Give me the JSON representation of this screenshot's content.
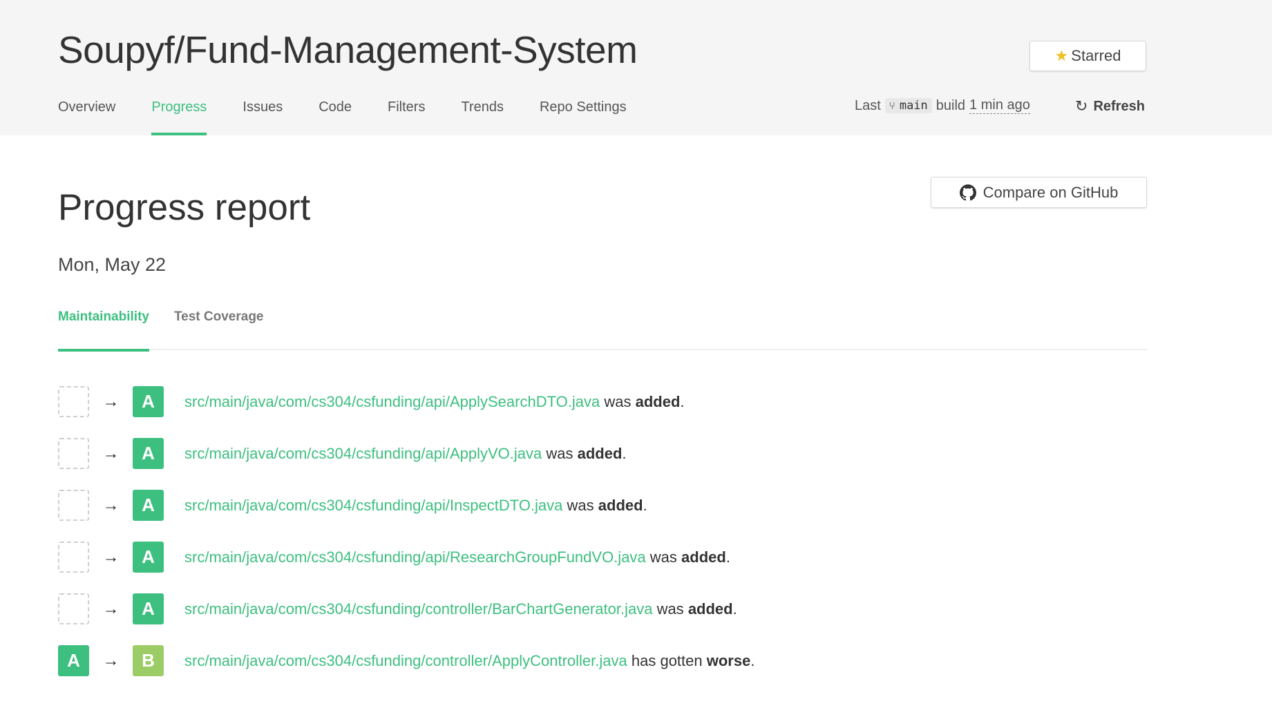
{
  "header": {
    "repo_title": "Soupyf/Fund-Management-System",
    "starred_label": "Starred",
    "nav": [
      {
        "label": "Overview"
      },
      {
        "label": "Progress"
      },
      {
        "label": "Issues"
      },
      {
        "label": "Code"
      },
      {
        "label": "Filters"
      },
      {
        "label": "Trends"
      },
      {
        "label": "Repo Settings"
      }
    ],
    "active_nav": "Progress",
    "build": {
      "prefix": "Last",
      "branch": "main",
      "middle": "build",
      "ago": "1 min ago"
    },
    "refresh_label": "Refresh"
  },
  "main": {
    "title": "Progress report",
    "compare_label": "Compare on GitHub",
    "date": "Mon, May 22",
    "tabs": [
      {
        "label": "Maintainability"
      },
      {
        "label": "Test Coverage"
      }
    ],
    "active_tab": "Maintainability",
    "changes": [
      {
        "from": "",
        "to": "A",
        "path": "src/main/java/com/cs304/csfunding/api/ApplySearchDTO.java",
        "verb": "was",
        "status": "added",
        "end": "."
      },
      {
        "from": "",
        "to": "A",
        "path": "src/main/java/com/cs304/csfunding/api/ApplyVO.java",
        "verb": "was",
        "status": "added",
        "end": "."
      },
      {
        "from": "",
        "to": "A",
        "path": "src/main/java/com/cs304/csfunding/api/InspectDTO.java",
        "verb": "was",
        "status": "added",
        "end": "."
      },
      {
        "from": "",
        "to": "A",
        "path": "src/main/java/com/cs304/csfunding/api/ResearchGroupFundVO.java",
        "verb": "was",
        "status": "added",
        "end": "."
      },
      {
        "from": "",
        "to": "A",
        "path": "src/main/java/com/cs304/csfunding/controller/BarChartGenerator.java",
        "verb": "was",
        "status": "added",
        "end": "."
      },
      {
        "from": "A",
        "to": "B",
        "path": "src/main/java/com/cs304/csfunding/controller/ApplyController.java",
        "verb": "has gotten",
        "status": "worse",
        "end": "."
      }
    ],
    "arrow_glyph": "→"
  },
  "colors": {
    "accent": "#3dbf7f",
    "grade_a": "#3dbf7f",
    "grade_b": "#9ccc65",
    "header_bg": "#f5f5f5"
  },
  "icons": {
    "star": "star-icon",
    "branch": "git-branch-icon",
    "refresh": "refresh-icon",
    "github": "github-icon",
    "arrow": "arrow-right-icon"
  }
}
